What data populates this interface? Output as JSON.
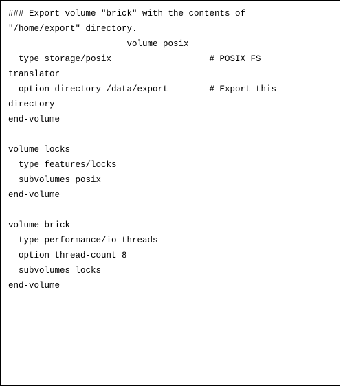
{
  "code": {
    "lines": [
      "### Export volume \"brick\" with the contents of",
      "\"/home/export\" directory.",
      "                       volume posix",
      "  type storage/posix                   # POSIX FS",
      "translator",
      "  option directory /data/export        # Export this",
      "directory",
      "end-volume",
      "",
      "volume locks",
      "  type features/locks",
      "  subvolumes posix",
      "end-volume",
      "",
      "volume brick",
      "  type performance/io-threads",
      "  option thread-count 8",
      "  subvolumes locks",
      "end-volume"
    ]
  }
}
